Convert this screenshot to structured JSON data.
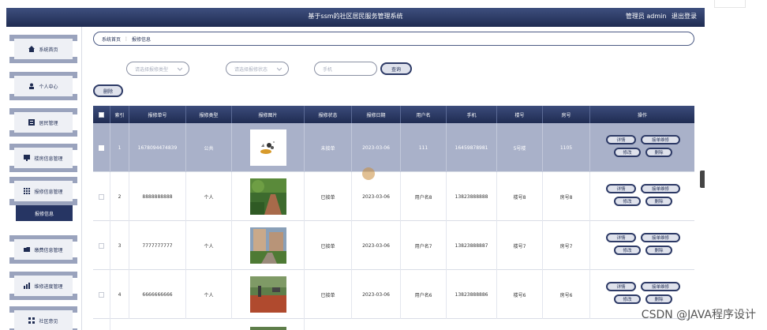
{
  "header": {
    "title": "基于ssm的社区居民服务管理系统",
    "user": "管理员 admin",
    "logout": "退出登录"
  },
  "sidebar": {
    "items": [
      {
        "label": "系统首页",
        "icon": "home-icon"
      },
      {
        "label": "个人中心",
        "icon": "user-icon"
      },
      {
        "label": "居民管理",
        "icon": "list-icon"
      },
      {
        "label": "楼房信息管理",
        "icon": "monitor-icon"
      },
      {
        "label": "报修信息管理",
        "icon": "grid-icon"
      },
      {
        "label": "缴费信息管理",
        "icon": "folder-icon"
      },
      {
        "label": "维修进度管理",
        "icon": "chart-icon"
      },
      {
        "label": "社区意见",
        "icon": "apps-icon"
      }
    ],
    "active_sub": "报修信息"
  },
  "breadcrumb": {
    "home": "系统首页",
    "separator": "⋮",
    "current": "报修信息"
  },
  "search": {
    "type_placeholder": "请选择报修类型",
    "status_placeholder": "请选择报修状态",
    "phone_placeholder": "手机",
    "query_label": "查询"
  },
  "toolbar": {
    "delete_label": "删除"
  },
  "table": {
    "headers": [
      "索引",
      "报修单号",
      "报修类型",
      "报修图片",
      "报修状态",
      "报修日期",
      "用户名",
      "手机",
      "楼号",
      "房号",
      "操作"
    ],
    "rows": [
      {
        "index": "1",
        "order_no": "1678094474839",
        "type": "公共",
        "status": "未接单",
        "date": "2023-03-06",
        "username": "111",
        "phone": "16459878981",
        "building": "5号楼",
        "room": "1105",
        "image": "cartoon",
        "selected": true
      },
      {
        "index": "2",
        "order_no": "8888888888",
        "type": "个人",
        "status": "已接单",
        "date": "2023-03-06",
        "username": "用户名8",
        "phone": "13823888888",
        "building": "楼号8",
        "room": "房号8",
        "image": "garden",
        "selected": false
      },
      {
        "index": "3",
        "order_no": "7777777777",
        "type": "个人",
        "status": "已接单",
        "date": "2023-03-06",
        "username": "用户名7",
        "phone": "13823888887",
        "building": "楼号7",
        "room": "房号7",
        "image": "apartments",
        "selected": false
      },
      {
        "index": "4",
        "order_no": "6666666666",
        "type": "个人",
        "status": "已接单",
        "date": "2023-03-06",
        "username": "用户名6",
        "phone": "13823888886",
        "building": "楼号6",
        "room": "房号6",
        "image": "playground",
        "selected": false
      }
    ],
    "actions": {
      "detail": "详情",
      "accept": "接单维修",
      "edit": "修改",
      "delete": "删除"
    }
  },
  "watermark": "CSDN @JAVA程序设计",
  "colors": {
    "primary": "#1f2c52",
    "selected_row": "#a9b1c9",
    "button_bg": "#dfe2ec"
  }
}
